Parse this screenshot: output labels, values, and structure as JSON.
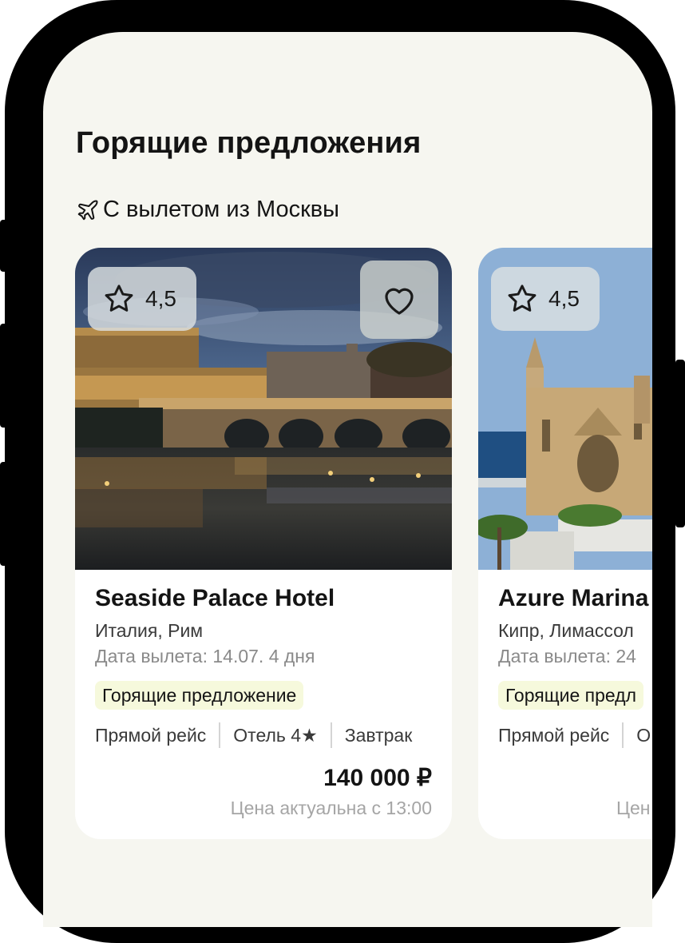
{
  "section": {
    "title": "Горящие предложения",
    "subtitle": "С вылетом из Москвы",
    "subtitle_icon": "airplane-icon"
  },
  "colors": {
    "background": "#f6f6f0",
    "badge_bg": "#f6f9dc",
    "text_primary": "#141414",
    "text_muted": "#8a8a8a"
  },
  "offers": [
    {
      "rating": "4,5",
      "favorite_icon": "heart-icon",
      "hotel_name": "Seaside Palace Hotel",
      "location": "Италия, Рим",
      "departure": "Дата вылета: 14.07. 4 дня",
      "badge": "Горящие предложение",
      "features": [
        "Прямой рейс",
        "Отель 4★",
        "Завтрак"
      ],
      "price": "140 000 ₽",
      "price_note": "Цена актуальна с 13:00"
    },
    {
      "rating": "4,5",
      "hotel_name": "Azure Marina",
      "location": "Кипр, Лимассол",
      "departure": "Дата вылета: 24",
      "badge": "Горящие предл",
      "features": [
        "Прямой рейс",
        "О"
      ],
      "price_note": "Цен"
    }
  ]
}
